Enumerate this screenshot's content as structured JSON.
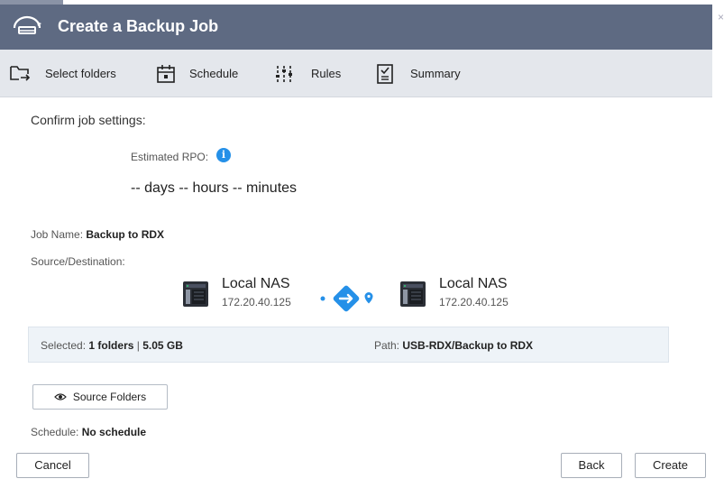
{
  "window": {
    "title": "Create a Backup Job",
    "close_glyph": "×"
  },
  "steps": [
    {
      "label": "Select folders",
      "icon": "folder-arrow-icon",
      "state": "done"
    },
    {
      "label": "Schedule",
      "icon": "calendar-icon",
      "state": "done"
    },
    {
      "label": "Rules",
      "icon": "sliders-icon",
      "state": "done"
    },
    {
      "label": "Summary",
      "icon": "checklist-icon",
      "state": "active"
    }
  ],
  "summary": {
    "heading": "Confirm job settings:",
    "rpo_label": "Estimated RPO:",
    "rpo_info_glyph": "i",
    "rpo_value": "-- days -- hours -- minutes",
    "job_name_label": "Job Name:",
    "job_name": "Backup to RDX",
    "srcdst_label": "Source/Destination:",
    "source": {
      "name": "Local NAS",
      "ip": "172.20.40.125"
    },
    "destination": {
      "name": "Local NAS",
      "ip": "172.20.40.125"
    },
    "selected_label": "Selected:",
    "selected_folders": "1 folders",
    "separator": "|",
    "selected_size": "5.05 GB",
    "path_label": "Path:",
    "path_value": "USB-RDX/Backup to RDX",
    "source_folders_button": "Source Folders",
    "schedule_label": "Schedule:",
    "schedule_value": "No schedule"
  },
  "footer": {
    "cancel": "Cancel",
    "back": "Back",
    "create": "Create"
  },
  "colors": {
    "titlebar": "#5e6a82",
    "accent": "#2590e8",
    "steps_bg": "#e4e7ec"
  }
}
